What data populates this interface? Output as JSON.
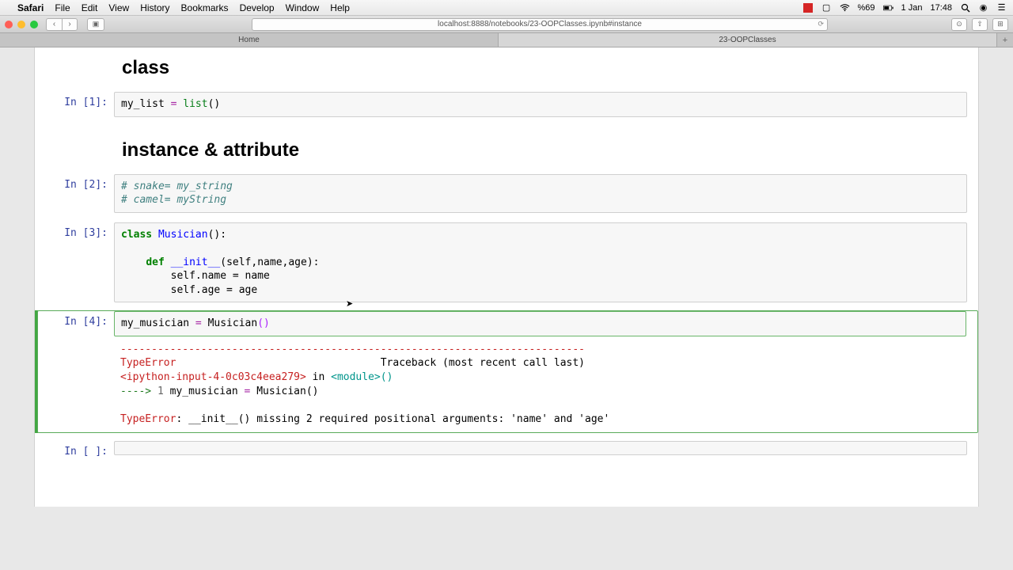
{
  "menubar": {
    "app": "Safari",
    "items": [
      "File",
      "Edit",
      "View",
      "History",
      "Bookmarks",
      "Develop",
      "Window",
      "Help"
    ],
    "status": {
      "battery": "%69",
      "date": "1 Jan",
      "time": "17:48"
    }
  },
  "browser": {
    "url": "localhost:8888/notebooks/23-OOPClasses.ipynb#instance",
    "tabs": [
      "Home",
      "23-OOPClasses"
    ],
    "active_tab": 1
  },
  "notebook": {
    "heading1": "class",
    "heading2": "instance & attribute",
    "prompts": {
      "p1": "In [1]:",
      "p2": "In [2]:",
      "p3": "In [3]:",
      "p4": "In [4]:",
      "p5": "In [ ]:"
    },
    "cell1": {
      "var": "my_list ",
      "eq": "=",
      "fn": " list",
      "paren": "()"
    },
    "cell2": {
      "l1": "# snake= my_string",
      "l2": "# camel= myString"
    },
    "cell3": {
      "kw_class": "class",
      "cls": " Musician",
      "cls_paren": "():",
      "kw_def": "def",
      "fn": " __init__",
      "sig": "(self,name,age):",
      "b1": "        self.name = name",
      "b2": "        self.age = age"
    },
    "cell4": {
      "var": "my_musician ",
      "eq": "=",
      "cls": " Musician",
      "paren": "()"
    },
    "error": {
      "sep": "---------------------------------------------------------------------------",
      "type": "TypeError",
      "traceback_lbl": "                                 Traceback (most recent call last)",
      "loc1a": "<ipython-input-4-0c03c4eea279>",
      "loc1b": " in ",
      "loc1c": "<module>",
      "loc1d": "()",
      "arrow": "----> ",
      "lineno": "1",
      "linecode": " my_musician ",
      "lineeq": "=",
      "lineafter": " Musician",
      "lineparen": "()",
      "final_type": "TypeError",
      "final_msg": ": __init__() missing 2 required positional arguments: 'name' and 'age'"
    }
  }
}
